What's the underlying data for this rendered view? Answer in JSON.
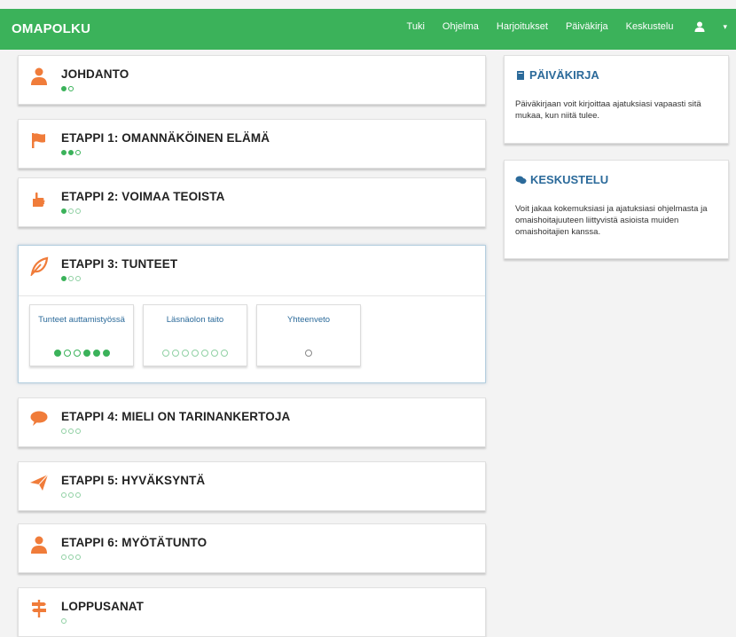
{
  "navbar": {
    "brand": "OMAPOLKU",
    "links": [
      "Tuki",
      "Ohjelma",
      "Harjoitukset",
      "Päiväkirja",
      "Keskustelu"
    ],
    "user_caret": "▾"
  },
  "colors": {
    "primary": "#3bb25a",
    "accent": "#f07c3a",
    "link": "#2b6a9a"
  },
  "phases": [
    {
      "title": "JOHDANTO",
      "icon": "person-icon",
      "progress": [
        "filled",
        "empty"
      ]
    },
    {
      "title": "ETAPPI 1: OMANNÄKÖINEN ELÄMÄ",
      "icon": "flag-icon",
      "progress": [
        "filled",
        "filled",
        "empty"
      ]
    },
    {
      "title": "ETAPPI 2: VOIMAA TEOISTA",
      "icon": "hand-icon",
      "progress": [
        "filled",
        "light",
        "light"
      ]
    },
    {
      "title": "ETAPPI 3: TUNTEET",
      "icon": "leaf-icon",
      "progress": [
        "filled",
        "light",
        "light"
      ]
    },
    {
      "title": "ETAPPI 4: MIELI ON TARINANKERTOJA",
      "icon": "speech-bubble-icon",
      "progress": [
        "light",
        "light",
        "light"
      ]
    },
    {
      "title": "ETAPPI 5: HYVÄKSYNTÄ",
      "icon": "paper-plane-icon",
      "progress": [
        "light",
        "light",
        "light"
      ]
    },
    {
      "title": "ETAPPI 6: MYÖTÄTUNTO",
      "icon": "person-icon",
      "progress": [
        "light",
        "light",
        "light"
      ]
    },
    {
      "title": "LOPPUSANAT",
      "icon": "signpost-icon",
      "progress": [
        "light"
      ]
    }
  ],
  "subexercises": [
    {
      "label": "Tunteet auttamistyössä",
      "progress": [
        "filled",
        "empty",
        "empty",
        "filled",
        "filled",
        "filled"
      ]
    },
    {
      "label": "Läsnäolon taito",
      "progress": [
        "light",
        "light",
        "light",
        "light",
        "light",
        "light",
        "light"
      ]
    },
    {
      "label": "Yhteenveto",
      "progress": [
        "light"
      ]
    }
  ],
  "sidebar": {
    "diary": {
      "title": "PÄIVÄKIRJA",
      "text": "Päiväkirjaan voit kirjoittaa ajatuksiasi vapaasti sitä mukaa, kun niitä tulee."
    },
    "discussion": {
      "title": "KESKUSTELU",
      "text": "Voit jakaa kokemuksiasi ja ajatuksiasi ohjelmasta ja omaishoitajuuteen liittyvistä asioista muiden omaishoitajien kanssa."
    }
  }
}
